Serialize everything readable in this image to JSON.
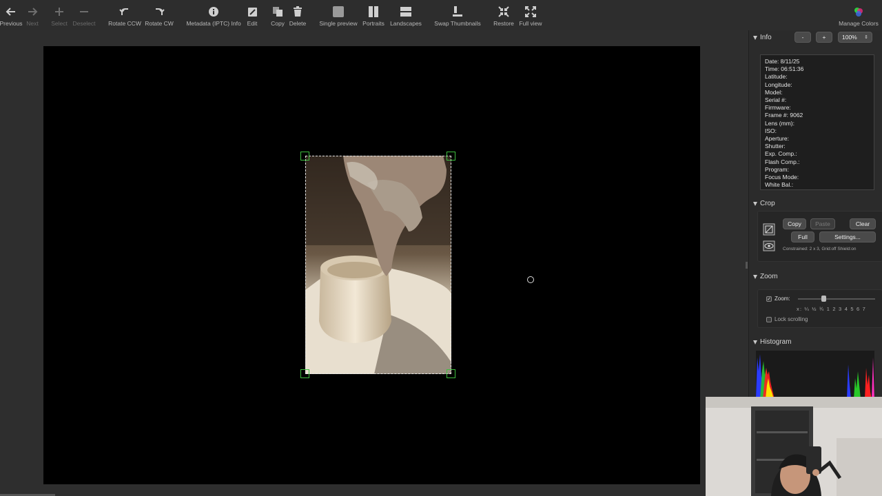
{
  "toolbar": {
    "items": [
      {
        "label": "Previous",
        "icon": "arrow-left-icon",
        "enabled": true
      },
      {
        "label": "Next",
        "icon": "arrow-right-icon",
        "enabled": false
      },
      {
        "label": "Select",
        "icon": "plus-icon",
        "enabled": false
      },
      {
        "label": "Deselect",
        "icon": "minus-icon",
        "enabled": false
      },
      {
        "label": "Rotate CCW",
        "icon": "rotate-ccw-icon",
        "enabled": true
      },
      {
        "label": "Rotate CW",
        "icon": "rotate-cw-icon",
        "enabled": true
      },
      {
        "label": "Metadata (IPTC) Info",
        "icon": "info-icon",
        "enabled": true
      },
      {
        "label": "Edit",
        "icon": "edit-icon",
        "enabled": true
      },
      {
        "label": "Copy",
        "icon": "copy-icon",
        "enabled": true
      },
      {
        "label": "Delete",
        "icon": "trash-icon",
        "enabled": true
      },
      {
        "label": "Single preview",
        "icon": "single-preview-icon",
        "enabled": true
      },
      {
        "label": "Portraits",
        "icon": "portraits-icon",
        "enabled": true
      },
      {
        "label": "Landscapes",
        "icon": "landscapes-icon",
        "enabled": true
      },
      {
        "label": "Swap Thumbnails",
        "icon": "swap-thumbnails-icon",
        "enabled": true
      },
      {
        "label": "Restore",
        "icon": "restore-icon",
        "enabled": true
      },
      {
        "label": "Full view",
        "icon": "full-view-icon",
        "enabled": true
      },
      {
        "label": "Manage Colors",
        "icon": "color-wheel-icon",
        "enabled": true
      }
    ]
  },
  "info": {
    "title": "Info",
    "minus": "-",
    "plus": "+",
    "zoom_value": "100%",
    "lines": [
      "Date: 8/11/25",
      "Time: 06:51:36",
      "Latitude:",
      "Longitude:",
      "Model:",
      "Serial #:",
      "Firmware:",
      "Frame #: 9062",
      "Lens (mm):",
      "ISO:",
      "Aperture:",
      "Shutter:",
      "Exp. Comp.:",
      "Flash Comp.:",
      "Program:",
      "Focus Mode:",
      "White Bal.:"
    ]
  },
  "crop": {
    "title": "Crop",
    "copy": "Copy",
    "paste": "Paste",
    "clear": "Clear",
    "full": "Full",
    "settings": "Settings...",
    "status": "Constrained: 2 x 3, Grid:off Shield:on"
  },
  "zoom": {
    "title": "Zoom",
    "label": "Zoom:",
    "checked": true,
    "scale": "x: ¼ ½ ¾ 1 2 3 4 5 6 7",
    "lock_label": "Lock scrolling",
    "lock_checked": false
  },
  "histogram": {
    "title": "Histogram"
  },
  "colors": {
    "accent_green": "#3fbf3f",
    "background": "#2e2e2e",
    "canvas": "#000000"
  }
}
